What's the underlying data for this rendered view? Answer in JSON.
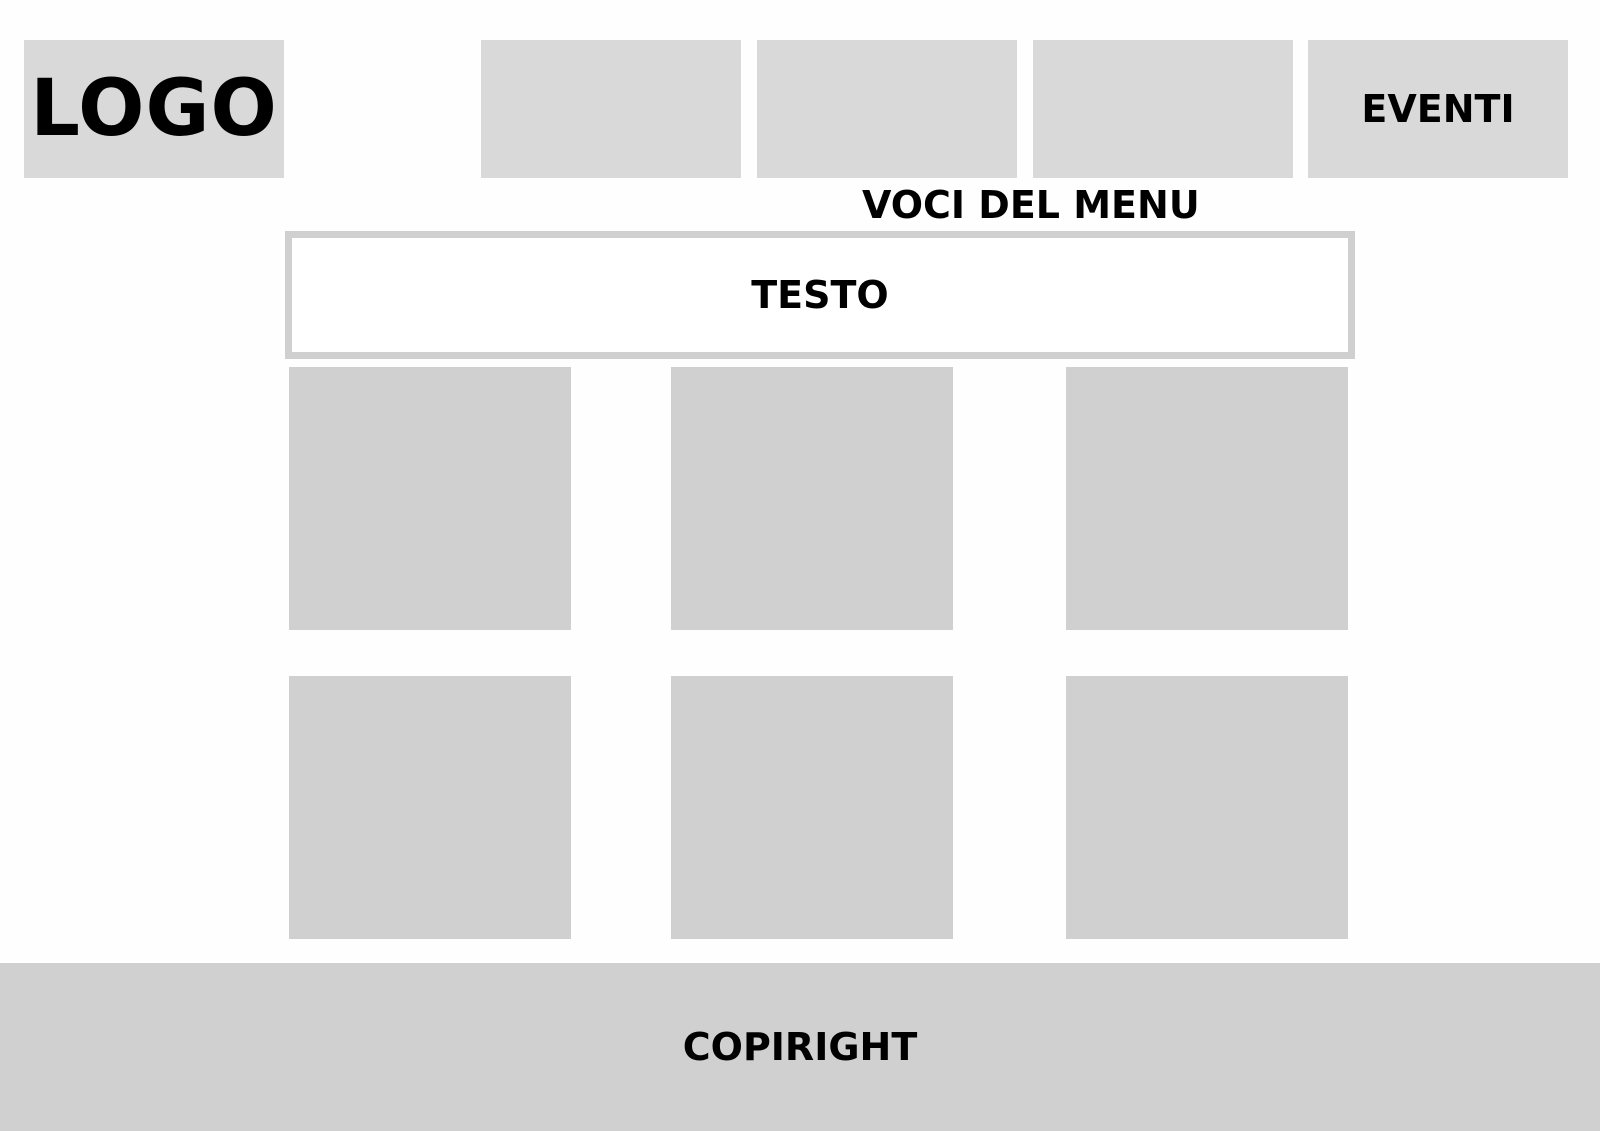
{
  "header": {
    "logo_text": "LOGO",
    "menu_items": [
      {
        "label": ""
      },
      {
        "label": ""
      },
      {
        "label": ""
      },
      {
        "label": "EVENTI"
      }
    ],
    "menu_caption": "VOCI DEL MENU"
  },
  "main": {
    "text_block": "TESTO"
  },
  "footer": {
    "copyright": "COPIRIGHT"
  },
  "colors": {
    "placeholder_gray": "#d9d9d9",
    "tile_gray": "#d0d0d0",
    "background": "#ffffff",
    "text": "#000000"
  }
}
